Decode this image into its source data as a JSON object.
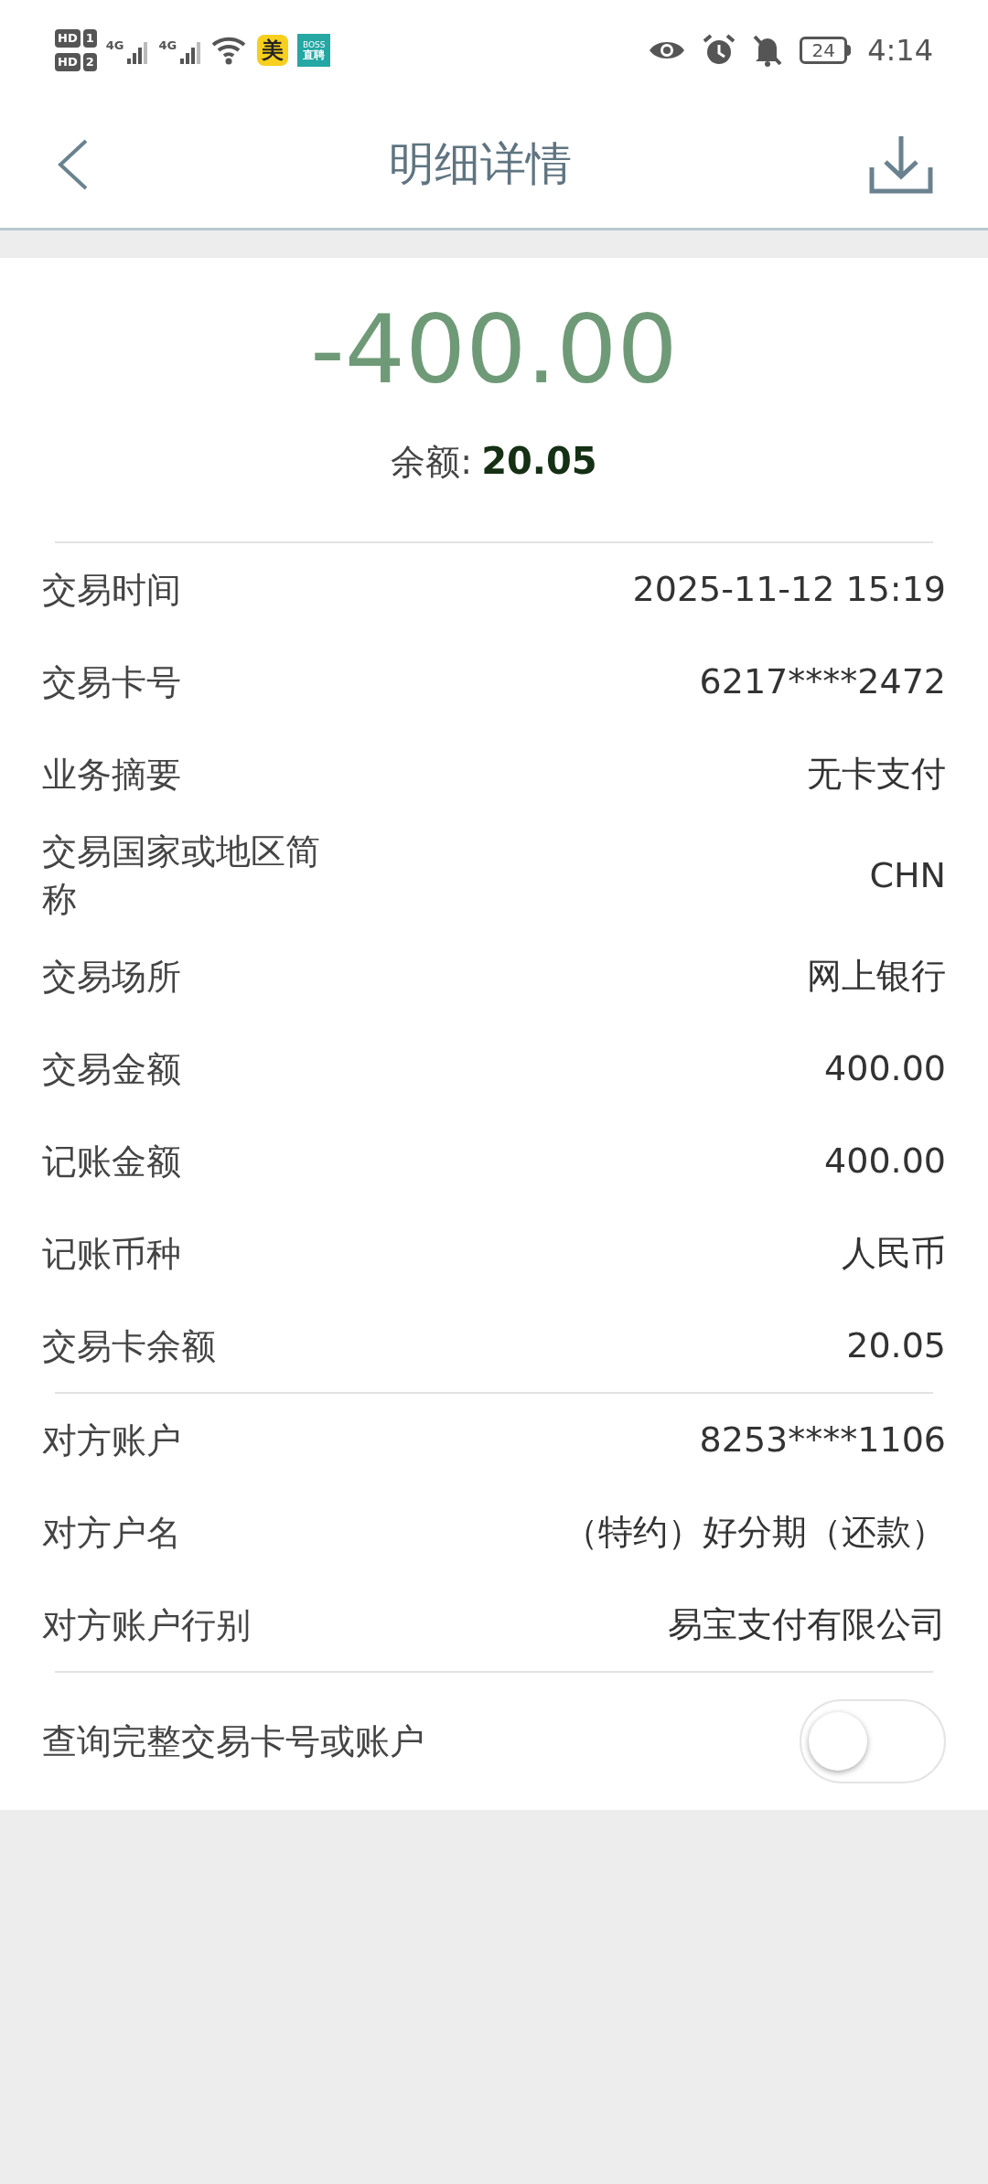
{
  "status_bar": {
    "sim_labels": [
      {
        "hd": "HD",
        "slot": "1"
      },
      {
        "hd": "HD",
        "slot": "2"
      }
    ],
    "networks": [
      "4G",
      "4G"
    ],
    "app_badges": [
      {
        "kind": "mei",
        "lines": [
          "美"
        ]
      },
      {
        "kind": "boss",
        "lines": [
          "BOSS",
          "直聘"
        ]
      }
    ],
    "battery": "24",
    "time": "4:14"
  },
  "header": {
    "title": "明细详情"
  },
  "summary": {
    "amount": "-400.00",
    "balance_label": "余额:",
    "balance_value": "20.05"
  },
  "groups": [
    {
      "rows": [
        {
          "label": "交易时间",
          "value": "2025-11-12 15:19"
        },
        {
          "label": "交易卡号",
          "value": "6217****2472"
        },
        {
          "label": "业务摘要",
          "value": "无卡支付"
        },
        {
          "label": "交易国家或地区简称",
          "value": "CHN"
        },
        {
          "label": "交易场所",
          "value": "网上银行"
        },
        {
          "label": "交易金额",
          "value": "400.00"
        },
        {
          "label": "记账金额",
          "value": "400.00"
        },
        {
          "label": "记账币种",
          "value": "人民币"
        },
        {
          "label": "交易卡余额",
          "value": "20.05"
        }
      ]
    },
    {
      "rows": [
        {
          "label": "对方账户",
          "value": "8253****1106"
        },
        {
          "label": "对方户名",
          "value": "（特约）好分期（还款）"
        },
        {
          "label": "对方账户行别",
          "value": "易宝支付有限公司"
        }
      ]
    }
  ],
  "toggle_row": {
    "label": "查询完整交易卡号或账户",
    "on": false
  }
}
